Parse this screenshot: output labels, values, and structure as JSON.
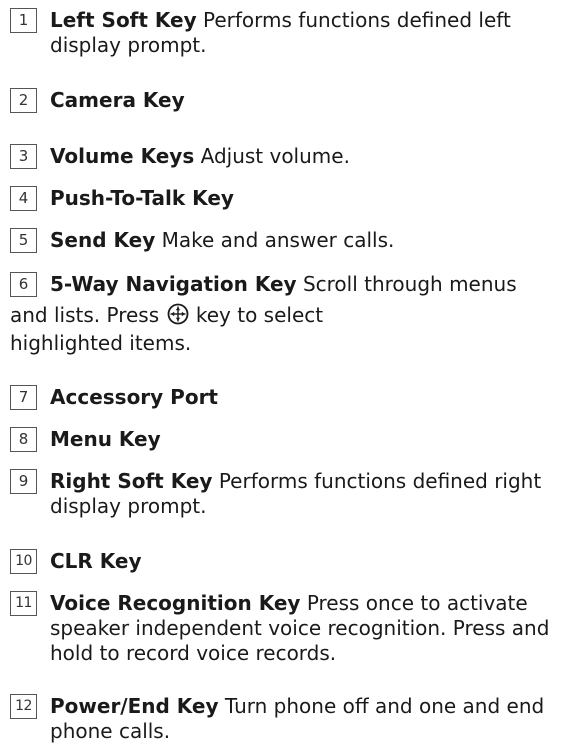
{
  "items": [
    {
      "num": "1",
      "term": "Left Soft Key",
      "desc": "Performs functions defined left",
      "desc2": "display prompt."
    },
    {
      "num": "2",
      "term": "Camera Key",
      "desc": ""
    },
    {
      "num": "3",
      "term": "Volume Keys",
      "desc": "Adjust volume."
    },
    {
      "num": "4",
      "term": "Push-To-Talk Key",
      "desc": ""
    },
    {
      "num": "5",
      "term": "Send Key",
      "desc": "Make and answer calls."
    },
    {
      "num": "6",
      "term": "5-Way Navigation Key",
      "desc": "Scroll through menus",
      "desc2a": "and lists. Press",
      "desc2b": "key to select",
      "desc3": "highlighted items.",
      "icon": "navigation-key-icon"
    },
    {
      "num": "7",
      "term": "Accessory Port",
      "desc": ""
    },
    {
      "num": "8",
      "term": "Menu Key",
      "desc": ""
    },
    {
      "num": "9",
      "term": "Right Soft Key",
      "desc": "Performs functions defined right",
      "desc2": "display prompt."
    },
    {
      "num": "10",
      "term": "CLR Key",
      "desc": ""
    },
    {
      "num": "11",
      "term": "Voice Recognition Key",
      "desc": "Press once to activate",
      "desc2": "speaker independent voice recognition. Press and",
      "desc3": "hold to record voice records."
    },
    {
      "num": "12",
      "term": "Power/End Key",
      "desc": "Turn phone off and one and end",
      "desc2": "phone calls."
    }
  ]
}
